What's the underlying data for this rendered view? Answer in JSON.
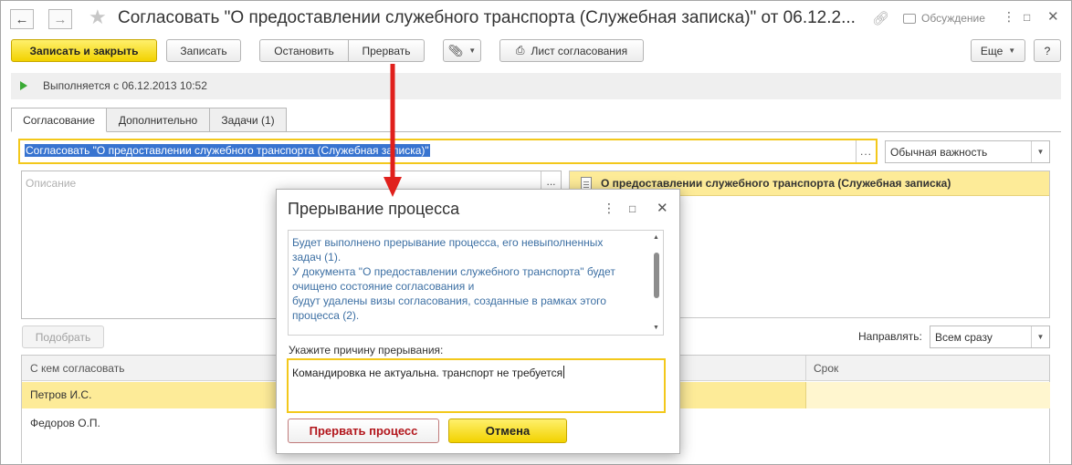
{
  "window": {
    "title": "Согласовать \"О предоставлении служебного транспорта (Служебная записка)\" от 06.12.2...",
    "discussion": "Обсуждение"
  },
  "toolbar": {
    "write_close": "Записать и закрыть",
    "write": "Записать",
    "stop": "Остановить",
    "abort": "Прервать",
    "approval_sheet": "Лист согласования",
    "more": "Еще",
    "help": "?"
  },
  "status": {
    "text": "Выполняется с 06.12.2013 10:52"
  },
  "tabs": [
    {
      "label": "Согласование",
      "active": true
    },
    {
      "label": "Дополнительно",
      "active": false
    },
    {
      "label": "Задачи (1)",
      "active": false
    }
  ],
  "form": {
    "subject": "Согласовать \"О предоставлении служебного транспорта (Служебная записка)\"",
    "importance": "Обычная важность",
    "description_placeholder": "Описание",
    "attachment": "О предоставлении служебного транспорта (Служебная записка)",
    "pick_button": "Подобрать",
    "direction_label": "Направлять:",
    "direction_value": "Всем сразу"
  },
  "grid": {
    "columns": [
      "С кем согласовать",
      "Срок"
    ],
    "rows": [
      {
        "name": "Петров И.С.",
        "selected": true
      },
      {
        "name": "Федоров О.П.",
        "selected": false
      }
    ]
  },
  "dialog": {
    "title": "Прерывание процесса",
    "message_lines": [
      "Будет выполнено прерывание процесса, его невыполненных",
      "задач (1).",
      "У документа \"О предоставлении служебного транспорта\" будет",
      "очищено состояние согласования и",
      "будут удалены визы согласования, созданные в рамках этого",
      "процесса (2)."
    ],
    "reason_label": "Укажите причину прерывания:",
    "reason_value": "Командировка не актуальна. транспорт не требуется",
    "abort_button": "Прервать процесс",
    "cancel_button": "Отмена"
  },
  "colors": {
    "primary_yellow": "#f2d200",
    "selection_yellow": "#fdeb98",
    "focus_border": "#f3c81b",
    "message_text": "#3c6fa3",
    "danger_text": "#b2151b",
    "annotation_arrow": "#e0201c",
    "status_play": "#3aaa35"
  },
  "icons": {
    "back": "arrow-left-icon",
    "forward": "arrow-right-icon",
    "favorite": "star-icon",
    "link": "link-icon",
    "discussion": "chat-icon",
    "more_vert": "kebab-icon",
    "close": "close-icon",
    "attach": "paperclip-icon",
    "print": "printer-icon"
  }
}
